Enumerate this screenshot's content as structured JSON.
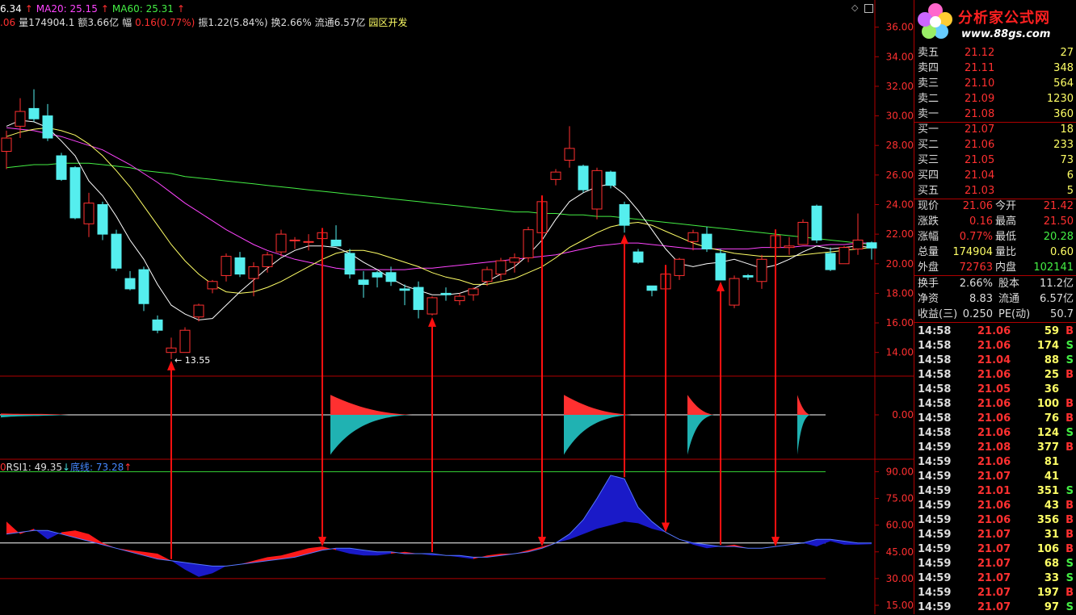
{
  "header": {
    "row1": [
      {
        "text": "6.34",
        "color": "#ffffff"
      },
      {
        "text": "↑",
        "color": "#ff3030"
      },
      {
        "text": "MA20: 25.15",
        "color": "#ff44ff"
      },
      {
        "text": "↑",
        "color": "#ff3030"
      },
      {
        "text": "MA60: 25.31",
        "color": "#44ee44"
      },
      {
        "text": "↑",
        "color": "#ff3030"
      }
    ],
    "row2": [
      {
        "text": ".06",
        "color": "#ff3030"
      },
      {
        "text": "量174904.1",
        "color": "#dddddd"
      },
      {
        "text": "额3.66亿",
        "color": "#dddddd"
      },
      {
        "text": "幅",
        "color": "#dddddd"
      },
      {
        "text": "0.16(0.77%)",
        "color": "#ff3030"
      },
      {
        "text": "振1.22(5.84%)",
        "color": "#dddddd"
      },
      {
        "text": "换2.66%",
        "color": "#dddddd"
      },
      {
        "text": "流通6.57亿",
        "color": "#dddddd"
      },
      {
        "text": "园区开发",
        "color": "#ffff66"
      }
    ]
  },
  "sub_header": [
    {
      "text": "0",
      "color": "#ff3030"
    },
    {
      "text": "RSI1: 49.35",
      "color": "#dddddd"
    },
    {
      "text": "↓",
      "color": "#44dddd"
    },
    {
      "text": "底线: 73.28",
      "color": "#4488ff"
    },
    {
      "text": "↑",
      "color": "#ff3030"
    }
  ],
  "logo": {
    "title": "分析家公式网",
    "url": "www.88gs.com"
  },
  "price_low_label": "13.55",
  "price_axis": [
    "36.00",
    "34.00",
    "32.00",
    "30.00",
    "28.00",
    "26.00",
    "24.00",
    "22.00",
    "20.00",
    "18.00",
    "16.00",
    "14.00"
  ],
  "mid_axis": [
    "0.00"
  ],
  "rsi_axis": [
    "90.00",
    "75.00",
    "60.00",
    "45.00",
    "30.00",
    "15.00"
  ],
  "order_book": [
    {
      "label": "卖五",
      "price": "21.12",
      "vol": "27"
    },
    {
      "label": "卖四",
      "price": "21.11",
      "vol": "348"
    },
    {
      "label": "卖三",
      "price": "21.10",
      "vol": "564"
    },
    {
      "label": "卖二",
      "price": "21.09",
      "vol": "1230"
    },
    {
      "label": "卖一",
      "price": "21.08",
      "vol": "360"
    },
    {
      "label": "买一",
      "price": "21.07",
      "vol": "18"
    },
    {
      "label": "买二",
      "price": "21.06",
      "vol": "233"
    },
    {
      "label": "买三",
      "price": "21.05",
      "vol": "73"
    },
    {
      "label": "买四",
      "price": "21.04",
      "vol": "6"
    },
    {
      "label": "买五",
      "price": "21.03",
      "vol": "5"
    }
  ],
  "quote": [
    {
      "l1": "现价",
      "v1": "21.06",
      "c1": "#ff3030",
      "l2": "今开",
      "v2": "21.42",
      "c2": "#ff3030"
    },
    {
      "l1": "涨跌",
      "v1": "0.16",
      "c1": "#ff3030",
      "l2": "最高",
      "v2": "21.50",
      "c2": "#ff3030"
    },
    {
      "l1": "涨幅",
      "v1": "0.77%",
      "c1": "#ff3030",
      "l2": "最低",
      "v2": "20.28",
      "c2": "#44ee44"
    },
    {
      "l1": "总量",
      "v1": "174904",
      "c1": "#ffff66",
      "l2": "量比",
      "v2": "0.60",
      "c2": "#ffff66"
    },
    {
      "l1": "外盘",
      "v1": "72763",
      "c1": "#ff3030",
      "l2": "内盘",
      "v2": "102141",
      "c2": "#44ee44"
    }
  ],
  "stats": [
    {
      "l1": "换手",
      "v1": "2.66%",
      "l2": "股本",
      "v2": "11.2亿"
    },
    {
      "l1": "净资",
      "v1": "8.83",
      "l2": "流通",
      "v2": "6.57亿"
    },
    {
      "l1": "收益(三)",
      "v1": "0.250",
      "l2": "PE(动)",
      "v2": "50.7"
    }
  ],
  "ticks": [
    {
      "t": "14:58",
      "p": "21.06",
      "v": "59",
      "s": "B"
    },
    {
      "t": "14:58",
      "p": "21.06",
      "v": "174",
      "s": "S"
    },
    {
      "t": "14:58",
      "p": "21.04",
      "v": "88",
      "s": "S"
    },
    {
      "t": "14:58",
      "p": "21.06",
      "v": "25",
      "s": "B"
    },
    {
      "t": "14:58",
      "p": "21.05",
      "v": "36",
      "s": ""
    },
    {
      "t": "14:58",
      "p": "21.06",
      "v": "100",
      "s": "B"
    },
    {
      "t": "14:58",
      "p": "21.06",
      "v": "76",
      "s": "B"
    },
    {
      "t": "14:58",
      "p": "21.06",
      "v": "124",
      "s": "S"
    },
    {
      "t": "14:59",
      "p": "21.08",
      "v": "377",
      "s": "B"
    },
    {
      "t": "14:59",
      "p": "21.06",
      "v": "81",
      "s": ""
    },
    {
      "t": "14:59",
      "p": "21.07",
      "v": "41",
      "s": ""
    },
    {
      "t": "14:59",
      "p": "21.01",
      "v": "351",
      "s": "S"
    },
    {
      "t": "14:59",
      "p": "21.06",
      "v": "43",
      "s": "B"
    },
    {
      "t": "14:59",
      "p": "21.06",
      "v": "356",
      "s": "B"
    },
    {
      "t": "14:59",
      "p": "21.07",
      "v": "31",
      "s": "B"
    },
    {
      "t": "14:59",
      "p": "21.07",
      "v": "106",
      "s": "B"
    },
    {
      "t": "14:59",
      "p": "21.07",
      "v": "68",
      "s": "S"
    },
    {
      "t": "14:59",
      "p": "21.07",
      "v": "33",
      "s": "S"
    },
    {
      "t": "14:59",
      "p": "21.07",
      "v": "197",
      "s": "B"
    },
    {
      "t": "14:59",
      "p": "21.07",
      "v": "97",
      "s": "S"
    }
  ],
  "colors": {
    "up": "#ff3030",
    "down": "#55eeee",
    "ma5": "#ffffff",
    "ma10": "#ffff66",
    "ma20": "#ff44ff",
    "ma60": "#44ee44",
    "rsi_up": "#ff1a1a",
    "rsi_down": "#1a1ac8",
    "rsi_line": "#5577ff",
    "teal": "#20b2b2",
    "grid": "#b00000"
  },
  "chart_data": [
    {
      "type": "candlestick",
      "title": "",
      "ylim": [
        12.4,
        37.4
      ],
      "candles": [
        {
          "o": 27.6,
          "h": 29.0,
          "l": 26.4,
          "c": 28.5
        },
        {
          "o": 29.3,
          "h": 31.2,
          "l": 28.5,
          "c": 30.3
        },
        {
          "o": 30.5,
          "h": 31.8,
          "l": 29.6,
          "c": 29.8
        },
        {
          "o": 30.0,
          "h": 30.8,
          "l": 28.3,
          "c": 28.5
        },
        {
          "o": 27.3,
          "h": 27.5,
          "l": 25.6,
          "c": 25.7
        },
        {
          "o": 26.5,
          "h": 26.6,
          "l": 23.0,
          "c": 23.1
        },
        {
          "o": 22.7,
          "h": 24.8,
          "l": 21.8,
          "c": 24.1
        },
        {
          "o": 24.0,
          "h": 24.2,
          "l": 21.6,
          "c": 22.0
        },
        {
          "o": 22.0,
          "h": 22.3,
          "l": 19.5,
          "c": 19.7
        },
        {
          "o": 19.0,
          "h": 19.5,
          "l": 18.2,
          "c": 18.3
        },
        {
          "o": 19.6,
          "h": 19.8,
          "l": 16.8,
          "c": 17.3
        },
        {
          "o": 16.2,
          "h": 16.5,
          "l": 15.3,
          "c": 15.5
        },
        {
          "o": 14.0,
          "h": 15.0,
          "l": 13.55,
          "c": 14.3
        },
        {
          "o": 14.0,
          "h": 15.7,
          "l": 14.0,
          "c": 15.5
        },
        {
          "o": 16.4,
          "h": 17.3,
          "l": 16.1,
          "c": 17.2
        },
        {
          "o": 18.3,
          "h": 18.9,
          "l": 18.0,
          "c": 18.8
        },
        {
          "o": 19.2,
          "h": 20.7,
          "l": 18.8,
          "c": 20.5
        },
        {
          "o": 20.4,
          "h": 20.8,
          "l": 19.1,
          "c": 19.3
        },
        {
          "o": 19.0,
          "h": 20.1,
          "l": 17.8,
          "c": 19.8
        },
        {
          "o": 19.8,
          "h": 20.8,
          "l": 19.4,
          "c": 20.6
        },
        {
          "o": 20.8,
          "h": 22.3,
          "l": 20.5,
          "c": 22.0
        },
        {
          "o": 21.6,
          "h": 21.8,
          "l": 21.0,
          "c": 21.6
        },
        {
          "o": 21.5,
          "h": 22.0,
          "l": 20.9,
          "c": 21.5
        },
        {
          "o": 21.7,
          "h": 22.2,
          "l": 21.5,
          "c": 22.1
        },
        {
          "o": 21.6,
          "h": 22.6,
          "l": 21.3,
          "c": 21.2
        },
        {
          "o": 20.7,
          "h": 21.0,
          "l": 19.0,
          "c": 19.3
        },
        {
          "o": 18.9,
          "h": 19.5,
          "l": 17.7,
          "c": 18.6
        },
        {
          "o": 19.4,
          "h": 19.5,
          "l": 18.4,
          "c": 19.1
        },
        {
          "o": 19.4,
          "h": 19.8,
          "l": 18.5,
          "c": 18.8
        },
        {
          "o": 18.3,
          "h": 18.6,
          "l": 17.2,
          "c": 18.2
        },
        {
          "o": 18.4,
          "h": 18.8,
          "l": 16.3,
          "c": 16.9
        },
        {
          "o": 16.6,
          "h": 17.8,
          "l": 16.5,
          "c": 17.7
        },
        {
          "o": 18.0,
          "h": 18.4,
          "l": 17.5,
          "c": 17.9
        },
        {
          "o": 17.5,
          "h": 18.0,
          "l": 17.2,
          "c": 17.8
        },
        {
          "o": 17.9,
          "h": 18.4,
          "l": 17.5,
          "c": 18.3
        },
        {
          "o": 18.8,
          "h": 19.8,
          "l": 18.5,
          "c": 19.6
        },
        {
          "o": 19.3,
          "h": 20.4,
          "l": 18.9,
          "c": 20.2
        },
        {
          "o": 20.1,
          "h": 20.7,
          "l": 19.4,
          "c": 20.4
        },
        {
          "o": 20.4,
          "h": 22.5,
          "l": 20.1,
          "c": 22.3
        },
        {
          "o": 22.1,
          "h": 24.4,
          "l": 22.0,
          "c": 24.2
        },
        {
          "o": 25.7,
          "h": 26.4,
          "l": 25.3,
          "c": 26.2
        },
        {
          "o": 27.0,
          "h": 29.3,
          "l": 26.5,
          "c": 27.8
        },
        {
          "o": 26.6,
          "h": 26.7,
          "l": 24.8,
          "c": 25.0
        },
        {
          "o": 23.7,
          "h": 26.5,
          "l": 23.0,
          "c": 26.3
        },
        {
          "o": 26.2,
          "h": 26.3,
          "l": 25.1,
          "c": 25.3
        },
        {
          "o": 24.0,
          "h": 24.2,
          "l": 22.1,
          "c": 22.6
        },
        {
          "o": 20.8,
          "h": 21.0,
          "l": 20.0,
          "c": 20.1
        },
        {
          "o": 18.5,
          "h": 18.5,
          "l": 17.8,
          "c": 18.2
        },
        {
          "o": 18.3,
          "h": 19.7,
          "l": 17.4,
          "c": 19.3
        },
        {
          "o": 19.2,
          "h": 20.4,
          "l": 18.9,
          "c": 20.3
        },
        {
          "o": 21.5,
          "h": 22.3,
          "l": 20.9,
          "c": 22.1
        },
        {
          "o": 22.0,
          "h": 22.5,
          "l": 20.8,
          "c": 21.0
        },
        {
          "o": 20.7,
          "h": 21.0,
          "l": 18.9,
          "c": 18.9
        },
        {
          "o": 17.2,
          "h": 19.2,
          "l": 17.0,
          "c": 19.0
        },
        {
          "o": 19.2,
          "h": 19.3,
          "l": 18.9,
          "c": 19.1
        },
        {
          "o": 18.8,
          "h": 20.6,
          "l": 18.3,
          "c": 20.3
        },
        {
          "o": 21.1,
          "h": 22.1,
          "l": 20.8,
          "c": 21.9
        },
        {
          "o": 21.1,
          "h": 21.8,
          "l": 20.6,
          "c": 21.2
        },
        {
          "o": 21.3,
          "h": 23.0,
          "l": 21.3,
          "c": 22.8
        },
        {
          "o": 23.9,
          "h": 24.0,
          "l": 21.4,
          "c": 21.6
        },
        {
          "o": 20.7,
          "h": 21.1,
          "l": 19.5,
          "c": 19.6
        },
        {
          "o": 20.0,
          "h": 21.2,
          "l": 20.0,
          "c": 21.1
        },
        {
          "o": 21.0,
          "h": 23.4,
          "l": 20.6,
          "c": 21.6
        },
        {
          "o": 21.42,
          "h": 21.5,
          "l": 20.28,
          "c": 21.06
        }
      ],
      "ma5": [
        29.3,
        29.7,
        29.6,
        29.2,
        28.3,
        27.3,
        25.6,
        24.6,
        23.2,
        21.6,
        20.3,
        18.6,
        17.2,
        16.6,
        16.2,
        16.3,
        17.2,
        18.1,
        18.9,
        19.7,
        20.4,
        20.9,
        21.2,
        21.2,
        21.1,
        20.7,
        20.1,
        19.6,
        19.0,
        18.5,
        18.2,
        17.9,
        17.9,
        18.0,
        18.3,
        18.8,
        19.3,
        19.8,
        20.6,
        21.6,
        23.0,
        24.2,
        24.8,
        25.2,
        25.4,
        24.7,
        23.6,
        22.3,
        21.0,
        20.0,
        19.8,
        20.0,
        20.1,
        20.3,
        20.0,
        19.7,
        19.9,
        20.3,
        20.8,
        21.2,
        21.0,
        21.1,
        21.2,
        21.1
      ],
      "ma10": [
        28.6,
        28.9,
        29.1,
        29.2,
        29.0,
        28.7,
        28.1,
        27.3,
        26.3,
        25.2,
        23.9,
        22.6,
        21.3,
        20.2,
        19.3,
        18.6,
        18.1,
        18.0,
        18.1,
        18.4,
        18.8,
        19.3,
        19.8,
        20.3,
        20.7,
        20.9,
        20.9,
        20.7,
        20.4,
        20.1,
        19.8,
        19.4,
        19.1,
        18.9,
        18.6,
        18.6,
        18.8,
        19.0,
        19.4,
        19.8,
        20.4,
        21.1,
        21.6,
        22.1,
        22.5,
        22.7,
        22.8,
        22.6,
        22.2,
        21.8,
        21.4,
        21.1,
        20.9,
        20.7,
        20.6,
        20.5,
        20.5,
        20.5,
        20.6,
        20.7,
        20.8,
        20.9,
        21.0,
        21.1
      ],
      "ma20": [
        29.2,
        29.1,
        29.0,
        28.8,
        28.6,
        28.3,
        28.0,
        27.7,
        27.2,
        26.7,
        26.1,
        25.5,
        24.8,
        24.1,
        23.5,
        22.9,
        22.3,
        21.8,
        21.3,
        20.9,
        20.6,
        20.3,
        20.1,
        19.9,
        19.7,
        19.6,
        19.6,
        19.6,
        19.6,
        19.6,
        19.7,
        19.7,
        19.8,
        19.9,
        20.0,
        20.1,
        20.2,
        20.3,
        20.4,
        20.5,
        20.6,
        20.8,
        21.0,
        21.2,
        21.3,
        21.4,
        21.4,
        21.3,
        21.2,
        21.1,
        21.0,
        21.0,
        21.0,
        21.0,
        21.0,
        21.1,
        21.1,
        21.1,
        21.2,
        21.2,
        21.3,
        21.3,
        21.4,
        21.4
      ],
      "ma60": [
        26.5,
        26.6,
        26.7,
        26.7,
        26.8,
        26.8,
        26.8,
        26.7,
        26.6,
        26.5,
        26.3,
        26.2,
        26.1,
        25.9,
        25.8,
        25.7,
        25.6,
        25.5,
        25.4,
        25.3,
        25.2,
        25.1,
        25.0,
        24.9,
        24.8,
        24.7,
        24.6,
        24.5,
        24.4,
        24.3,
        24.2,
        24.1,
        24.0,
        23.9,
        23.8,
        23.7,
        23.6,
        23.5,
        23.5,
        23.4,
        23.4,
        23.3,
        23.3,
        23.2,
        23.2,
        23.1,
        23.0,
        22.9,
        22.8,
        22.7,
        22.6,
        22.5,
        22.4,
        22.3,
        22.2,
        22.1,
        22.0,
        21.9,
        21.8,
        21.7,
        21.6,
        21.5,
        21.4,
        21.3
      ]
    },
    {
      "type": "area",
      "title": "",
      "baseline": 0,
      "ylim": [
        -1,
        1
      ],
      "segments": [
        {
          "start": 0,
          "len": 5,
          "up": 0.03,
          "down": 0.06
        },
        {
          "start": 24,
          "len": 6,
          "up": 0.45,
          "down": 0.9
        },
        {
          "start": 41,
          "len": 5,
          "up": 0.45,
          "down": 0.9
        },
        {
          "start": 50,
          "len": 2,
          "up": 0.45,
          "down": 0.9
        },
        {
          "start": 58,
          "len": 1,
          "up": 0.45,
          "down": 0.9
        }
      ]
    },
    {
      "type": "area",
      "title": "",
      "ylim": [
        10,
        97
      ],
      "reference_lines": [
        90,
        50,
        30
      ],
      "rsi": [
        62,
        55,
        58,
        52,
        56,
        57,
        55,
        50,
        47,
        46,
        45,
        44,
        40,
        35,
        31,
        33,
        37,
        38,
        40,
        42,
        43,
        45,
        47,
        48,
        46,
        44,
        43,
        43,
        44,
        45,
        44,
        43,
        43,
        42,
        41,
        43,
        44,
        44,
        46,
        48,
        50,
        52,
        55,
        58,
        60,
        62,
        61,
        58,
        56,
        52,
        49,
        47,
        48,
        49,
        47,
        47,
        48,
        49,
        50,
        48,
        51,
        49,
        49,
        49.35
      ],
      "line": [
        55,
        56,
        57,
        57,
        55,
        53,
        51,
        49,
        47,
        45,
        43,
        41,
        40,
        39,
        38,
        37,
        37,
        38,
        39,
        40,
        41,
        42,
        44,
        46,
        47,
        47,
        46,
        45,
        45,
        44,
        44,
        44,
        43,
        43,
        42,
        42,
        43,
        44,
        45,
        47,
        50,
        55,
        63,
        75,
        88,
        86,
        70,
        62,
        56,
        52,
        50,
        49,
        48,
        48,
        47,
        47,
        48,
        49,
        50,
        52,
        52,
        51,
        50,
        50
      ]
    }
  ]
}
